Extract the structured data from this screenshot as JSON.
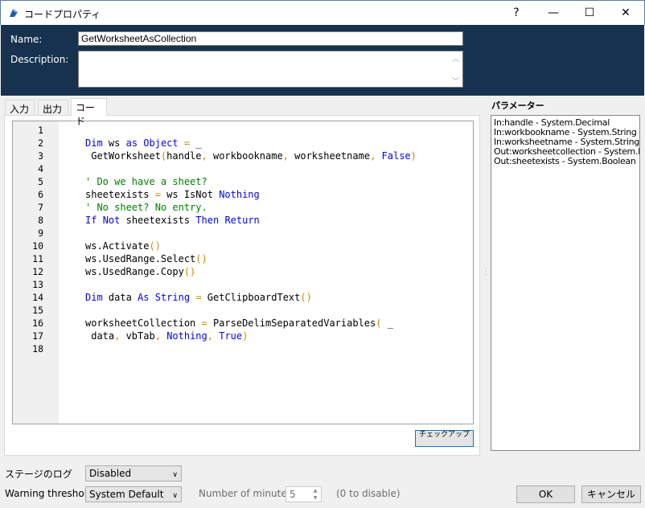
{
  "window": {
    "title": "コードプロパティ",
    "help_label": "?",
    "minimize_label": "—",
    "maximize_label": "☐",
    "close_label": "✕"
  },
  "header": {
    "name_label": "Name:",
    "name_value": "GetWorksheetAsCollection",
    "description_label": "Description:",
    "description_value": ""
  },
  "tabs": [
    {
      "label": "入力",
      "active": false
    },
    {
      "label": "出力",
      "active": false
    },
    {
      "label": "コード",
      "active": true
    }
  ],
  "code": {
    "line_numbers": [
      "1",
      "2",
      "3",
      "4",
      "5",
      "6",
      "7",
      "8",
      "9",
      "10",
      "11",
      "12",
      "13",
      "14",
      "15",
      "16",
      "17",
      "18"
    ],
    "check_button_label": "チェックアップ",
    "colors": {
      "keyword": "#0000ff",
      "comment": "#008000",
      "paren": "#cc8800"
    }
  },
  "parameters": {
    "title": "パラメーター",
    "items": [
      "In:handle - System.Decimal",
      "In:workbookname - System.String",
      "In:worksheetname - System.String",
      "Out:worksheetcollection - System.D",
      "Out:sheetexists - System.Boolean"
    ]
  },
  "footer": {
    "stage_log_label": "ステージのログ",
    "stage_log_value": "Disabled",
    "warning_label": "Warning threshold:",
    "warning_value": "System Default",
    "minutes_label": "Number of minutes",
    "minutes_value": "5",
    "minutes_hint": "(0 to disable)",
    "ok_label": "OK",
    "cancel_label": "キャンセル"
  }
}
